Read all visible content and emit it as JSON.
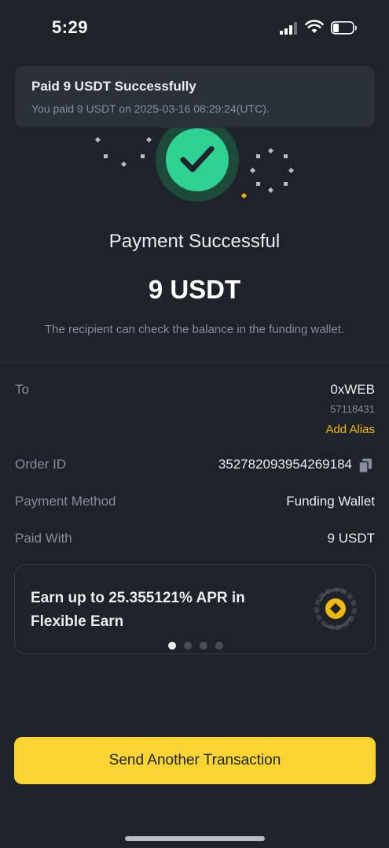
{
  "status_bar": {
    "time": "5:29",
    "signal_icon": "cellular-signal-icon",
    "wifi_icon": "wifi-icon",
    "battery_icon": "battery-low-icon"
  },
  "toast": {
    "title": "Paid 9 USDT Successfully",
    "subtitle": "You paid 9 USDT on 2025-03-16 08:29:24(UTC)."
  },
  "result": {
    "icon": "checkmark-icon",
    "title": "Payment Successful",
    "amount": "9 USDT",
    "note": "The recipient can check the balance in the funding wallet."
  },
  "details": {
    "to_label": "To",
    "to_name": "0xWEB",
    "to_id": "57118431",
    "add_alias": "Add Alias",
    "order_id_label": "Order ID",
    "order_id_value": "352782093954269184",
    "payment_method_label": "Payment Method",
    "payment_method_value": "Funding Wallet",
    "paid_with_label": "Paid With",
    "paid_with_value": "9 USDT"
  },
  "promo": {
    "text": "Earn up to 25.355121% APR in Flexible Earn",
    "icon": "flexible-earn-coin-icon",
    "page_count": 4,
    "active_page": 1
  },
  "footer": {
    "primary_button": "Send Another Transaction"
  },
  "colors": {
    "background": "#1e2329",
    "card": "#2b3139",
    "success_green": "#2ed393",
    "accent_yellow": "#fcd535",
    "link_yellow": "#f0b90b",
    "muted_text": "#848e9c"
  }
}
